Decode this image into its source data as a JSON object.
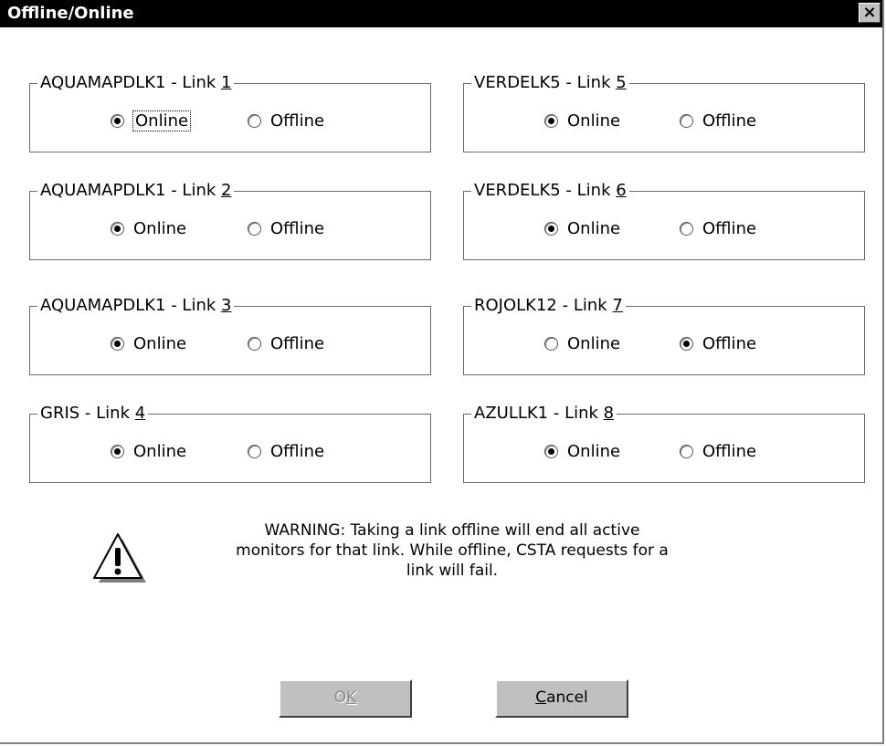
{
  "window": {
    "title": "Offline/Online",
    "close_glyph": "×"
  },
  "links": [
    {
      "name": "AQUAMAPDLK1 - Link ",
      "num": "1",
      "online_label": "Online",
      "offline_label": "Offline",
      "state": "online"
    },
    {
      "name": "AQUAMAPDLK1 - Link ",
      "num": "2",
      "online_label": "Online",
      "offline_label": "Offline",
      "state": "online"
    },
    {
      "name": "AQUAMAPDLK1 - Link ",
      "num": "3",
      "online_label": "Online",
      "offline_label": "Offline",
      "state": "online"
    },
    {
      "name": "GRIS - Link ",
      "num": "4",
      "online_label": "Online",
      "offline_label": "Offline",
      "state": "online"
    },
    {
      "name": "VERDELK5 - Link ",
      "num": "5",
      "online_label": "Online",
      "offline_label": "Offline",
      "state": "online"
    },
    {
      "name": "VERDELK5 - Link ",
      "num": "6",
      "online_label": "Online",
      "offline_label": "Offline",
      "state": "online"
    },
    {
      "name": "ROJOLK12 - Link ",
      "num": "7",
      "online_label": "Online",
      "offline_label": "Offline",
      "state": "offline"
    },
    {
      "name": "AZULLK1 - Link ",
      "num": "8",
      "online_label": "Online",
      "offline_label": "Offline",
      "state": "online"
    }
  ],
  "warning": {
    "icon": "warning-triangle-icon",
    "line1": "WARNING: Taking a link offline will end all active",
    "line2": "monitors for that link. While offline, CSTA requests for a",
    "line3": "link will fail."
  },
  "buttons": {
    "ok_pre": "O",
    "ok_underline": "K",
    "ok_enabled": false,
    "cancel_underline": "C",
    "cancel_rest": "ancel"
  }
}
